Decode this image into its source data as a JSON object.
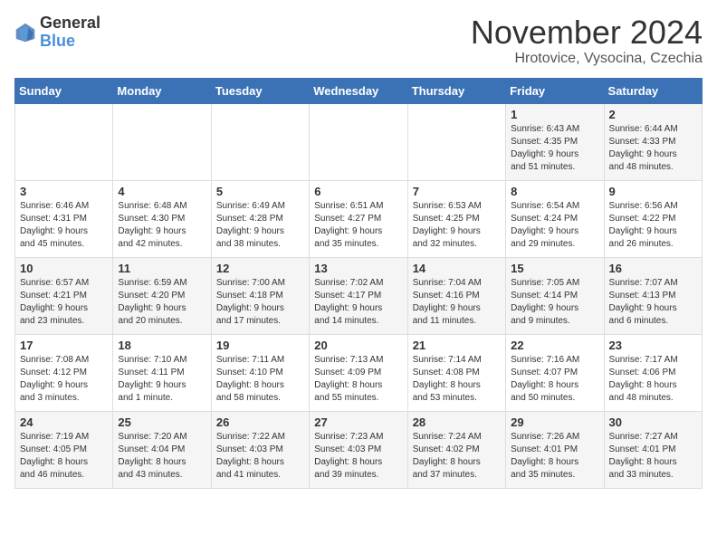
{
  "logo": {
    "general": "General",
    "blue": "Blue"
  },
  "title": "November 2024",
  "location": "Hrotovice, Vysocina, Czechia",
  "days_header": [
    "Sunday",
    "Monday",
    "Tuesday",
    "Wednesday",
    "Thursday",
    "Friday",
    "Saturday"
  ],
  "weeks": [
    [
      {
        "day": "",
        "info": ""
      },
      {
        "day": "",
        "info": ""
      },
      {
        "day": "",
        "info": ""
      },
      {
        "day": "",
        "info": ""
      },
      {
        "day": "",
        "info": ""
      },
      {
        "day": "1",
        "info": "Sunrise: 6:43 AM\nSunset: 4:35 PM\nDaylight: 9 hours\nand 51 minutes."
      },
      {
        "day": "2",
        "info": "Sunrise: 6:44 AM\nSunset: 4:33 PM\nDaylight: 9 hours\nand 48 minutes."
      }
    ],
    [
      {
        "day": "3",
        "info": "Sunrise: 6:46 AM\nSunset: 4:31 PM\nDaylight: 9 hours\nand 45 minutes."
      },
      {
        "day": "4",
        "info": "Sunrise: 6:48 AM\nSunset: 4:30 PM\nDaylight: 9 hours\nand 42 minutes."
      },
      {
        "day": "5",
        "info": "Sunrise: 6:49 AM\nSunset: 4:28 PM\nDaylight: 9 hours\nand 38 minutes."
      },
      {
        "day": "6",
        "info": "Sunrise: 6:51 AM\nSunset: 4:27 PM\nDaylight: 9 hours\nand 35 minutes."
      },
      {
        "day": "7",
        "info": "Sunrise: 6:53 AM\nSunset: 4:25 PM\nDaylight: 9 hours\nand 32 minutes."
      },
      {
        "day": "8",
        "info": "Sunrise: 6:54 AM\nSunset: 4:24 PM\nDaylight: 9 hours\nand 29 minutes."
      },
      {
        "day": "9",
        "info": "Sunrise: 6:56 AM\nSunset: 4:22 PM\nDaylight: 9 hours\nand 26 minutes."
      }
    ],
    [
      {
        "day": "10",
        "info": "Sunrise: 6:57 AM\nSunset: 4:21 PM\nDaylight: 9 hours\nand 23 minutes."
      },
      {
        "day": "11",
        "info": "Sunrise: 6:59 AM\nSunset: 4:20 PM\nDaylight: 9 hours\nand 20 minutes."
      },
      {
        "day": "12",
        "info": "Sunrise: 7:00 AM\nSunset: 4:18 PM\nDaylight: 9 hours\nand 17 minutes."
      },
      {
        "day": "13",
        "info": "Sunrise: 7:02 AM\nSunset: 4:17 PM\nDaylight: 9 hours\nand 14 minutes."
      },
      {
        "day": "14",
        "info": "Sunrise: 7:04 AM\nSunset: 4:16 PM\nDaylight: 9 hours\nand 11 minutes."
      },
      {
        "day": "15",
        "info": "Sunrise: 7:05 AM\nSunset: 4:14 PM\nDaylight: 9 hours\nand 9 minutes."
      },
      {
        "day": "16",
        "info": "Sunrise: 7:07 AM\nSunset: 4:13 PM\nDaylight: 9 hours\nand 6 minutes."
      }
    ],
    [
      {
        "day": "17",
        "info": "Sunrise: 7:08 AM\nSunset: 4:12 PM\nDaylight: 9 hours\nand 3 minutes."
      },
      {
        "day": "18",
        "info": "Sunrise: 7:10 AM\nSunset: 4:11 PM\nDaylight: 9 hours\nand 1 minute."
      },
      {
        "day": "19",
        "info": "Sunrise: 7:11 AM\nSunset: 4:10 PM\nDaylight: 8 hours\nand 58 minutes."
      },
      {
        "day": "20",
        "info": "Sunrise: 7:13 AM\nSunset: 4:09 PM\nDaylight: 8 hours\nand 55 minutes."
      },
      {
        "day": "21",
        "info": "Sunrise: 7:14 AM\nSunset: 4:08 PM\nDaylight: 8 hours\nand 53 minutes."
      },
      {
        "day": "22",
        "info": "Sunrise: 7:16 AM\nSunset: 4:07 PM\nDaylight: 8 hours\nand 50 minutes."
      },
      {
        "day": "23",
        "info": "Sunrise: 7:17 AM\nSunset: 4:06 PM\nDaylight: 8 hours\nand 48 minutes."
      }
    ],
    [
      {
        "day": "24",
        "info": "Sunrise: 7:19 AM\nSunset: 4:05 PM\nDaylight: 8 hours\nand 46 minutes."
      },
      {
        "day": "25",
        "info": "Sunrise: 7:20 AM\nSunset: 4:04 PM\nDaylight: 8 hours\nand 43 minutes."
      },
      {
        "day": "26",
        "info": "Sunrise: 7:22 AM\nSunset: 4:03 PM\nDaylight: 8 hours\nand 41 minutes."
      },
      {
        "day": "27",
        "info": "Sunrise: 7:23 AM\nSunset: 4:03 PM\nDaylight: 8 hours\nand 39 minutes."
      },
      {
        "day": "28",
        "info": "Sunrise: 7:24 AM\nSunset: 4:02 PM\nDaylight: 8 hours\nand 37 minutes."
      },
      {
        "day": "29",
        "info": "Sunrise: 7:26 AM\nSunset: 4:01 PM\nDaylight: 8 hours\nand 35 minutes."
      },
      {
        "day": "30",
        "info": "Sunrise: 7:27 AM\nSunset: 4:01 PM\nDaylight: 8 hours\nand 33 minutes."
      }
    ]
  ]
}
